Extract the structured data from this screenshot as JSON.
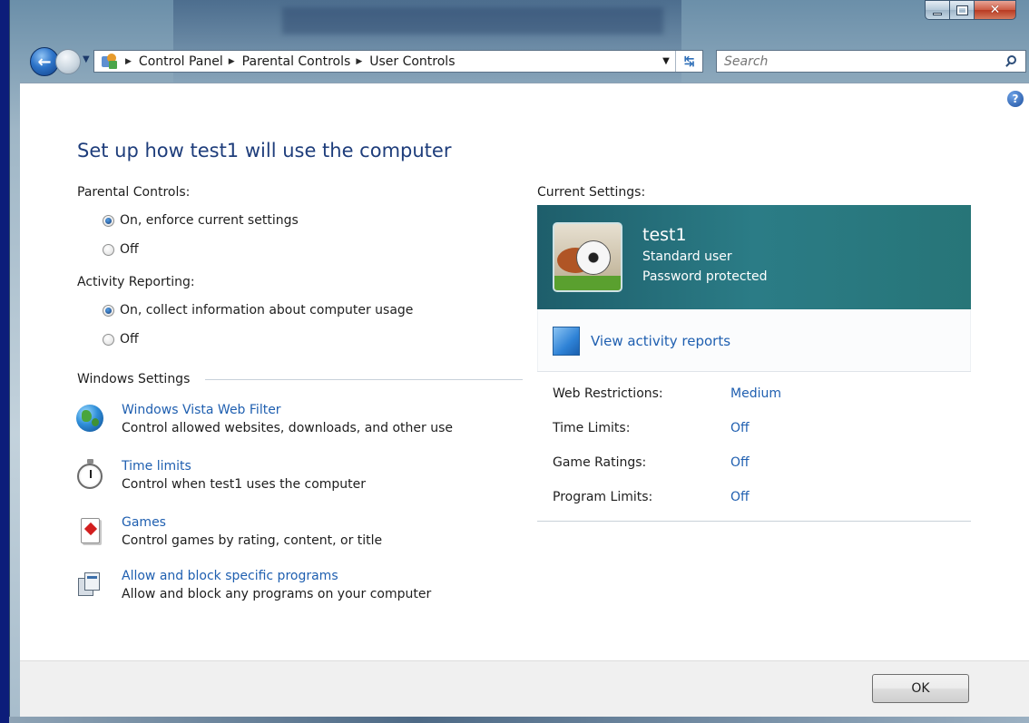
{
  "window": {
    "caption": {
      "minimize": "minimize",
      "maximize": "maximize",
      "close": "close"
    }
  },
  "nav": {
    "breadcrumb": [
      "Control Panel",
      "Parental Controls",
      "User Controls"
    ],
    "search": {
      "placeholder": "Search",
      "value": ""
    }
  },
  "page": {
    "title": "Set up how test1 will use the computer",
    "parental_controls": {
      "label": "Parental Controls:",
      "options": [
        {
          "label": "On, enforce current settings",
          "selected": true
        },
        {
          "label": "Off",
          "selected": false
        }
      ]
    },
    "activity_reporting": {
      "label": "Activity Reporting:",
      "options": [
        {
          "label": "On, collect information about computer usage",
          "selected": true
        },
        {
          "label": "Off",
          "selected": false
        }
      ]
    },
    "windows_settings": {
      "label": "Windows Settings",
      "items": [
        {
          "icon": "globe-icon",
          "link": "Windows Vista Web Filter",
          "desc": "Control allowed websites, downloads, and other use"
        },
        {
          "icon": "stopwatch-icon",
          "link": "Time limits",
          "desc": "Control when test1 uses the computer"
        },
        {
          "icon": "playing-card-icon",
          "link": "Games",
          "desc": "Control games by rating, content, or title"
        },
        {
          "icon": "programs-icon",
          "link": "Allow and block specific programs",
          "desc": "Allow and block any programs on your computer"
        }
      ]
    },
    "current_settings": {
      "label": "Current Settings:",
      "user": {
        "name": "test1",
        "type": "Standard user",
        "password": "Password protected"
      },
      "reports_link": "View activity reports",
      "rows": [
        {
          "name": "Web Restrictions:",
          "value": "Medium"
        },
        {
          "name": "Time Limits:",
          "value": "Off"
        },
        {
          "name": "Game Ratings:",
          "value": "Off"
        },
        {
          "name": "Program Limits:",
          "value": "Off"
        }
      ]
    }
  },
  "footer": {
    "ok_label": "OK"
  },
  "colors": {
    "link": "#1f5fb0",
    "title": "#1e3d7b",
    "user_banner": "#2b7c86"
  }
}
